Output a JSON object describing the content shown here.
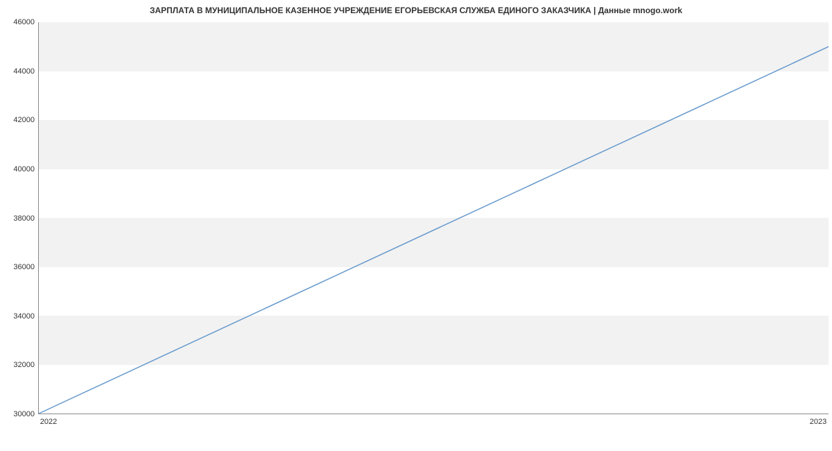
{
  "chart_data": {
    "type": "line",
    "title": "ЗАРПЛАТА В МУНИЦИПАЛЬНОЕ КАЗЕННОЕ УЧРЕЖДЕНИЕ ЕГОРЬЕВСКАЯ СЛУЖБА ЕДИНОГО ЗАКАЗЧИКА | Данные mnogo.work",
    "x": [
      "2022",
      "2023"
    ],
    "values": [
      30000,
      45000
    ],
    "xlabel": "",
    "ylabel": "",
    "ylim": [
      30000,
      46000
    ],
    "y_ticks": [
      30000,
      32000,
      34000,
      36000,
      38000,
      40000,
      42000,
      44000,
      46000
    ],
    "x_ticks": [
      "2022",
      "2023"
    ],
    "line_color": "#6699cc",
    "band_color": "#f2f2f2"
  }
}
